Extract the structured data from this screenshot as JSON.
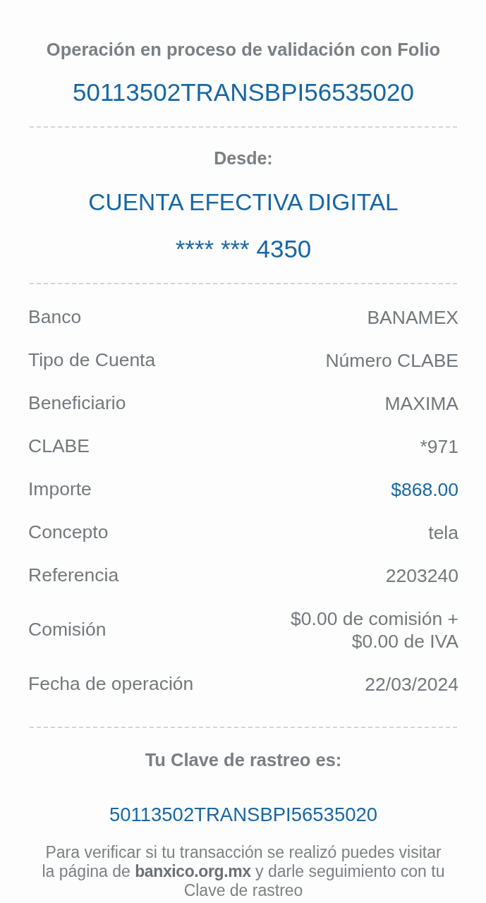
{
  "header": {
    "title": "Operación en proceso de validación con Folio",
    "folio": "50113502TRANSBPI56535020"
  },
  "origin": {
    "label": "Desde:",
    "account_name": "CUENTA EFECTIVA DIGITAL",
    "account_number": "**** *** 4350"
  },
  "details": [
    {
      "label": "Banco",
      "value": "BANAMEX",
      "kind": "text"
    },
    {
      "label": "Tipo de Cuenta",
      "value": "Número CLABE",
      "kind": "text"
    },
    {
      "label": "Beneficiario",
      "value": "MAXIMA",
      "kind": "text"
    },
    {
      "label": "CLABE",
      "value": "*971",
      "kind": "text"
    },
    {
      "label": "Importe",
      "value": "$868.00",
      "kind": "amount"
    },
    {
      "label": "Concepto",
      "value": "tela",
      "kind": "text"
    },
    {
      "label": "Referencia",
      "value": "2203240",
      "kind": "text"
    },
    {
      "label": "Comisión",
      "value": "$0.00 de comisión + $0.00 de IVA",
      "kind": "text"
    },
    {
      "label": "Fecha de operación",
      "value": "22/03/2024",
      "kind": "text"
    }
  ],
  "tracking": {
    "label": "Tu Clave de rastreo es:",
    "code": "50113502TRANSBPI56535020",
    "note": "Para verificar si tu transacción se realizó puedes visitar la página de **banxico.org.mx** y darle seguimiento con tu Clave de rastreo"
  }
}
